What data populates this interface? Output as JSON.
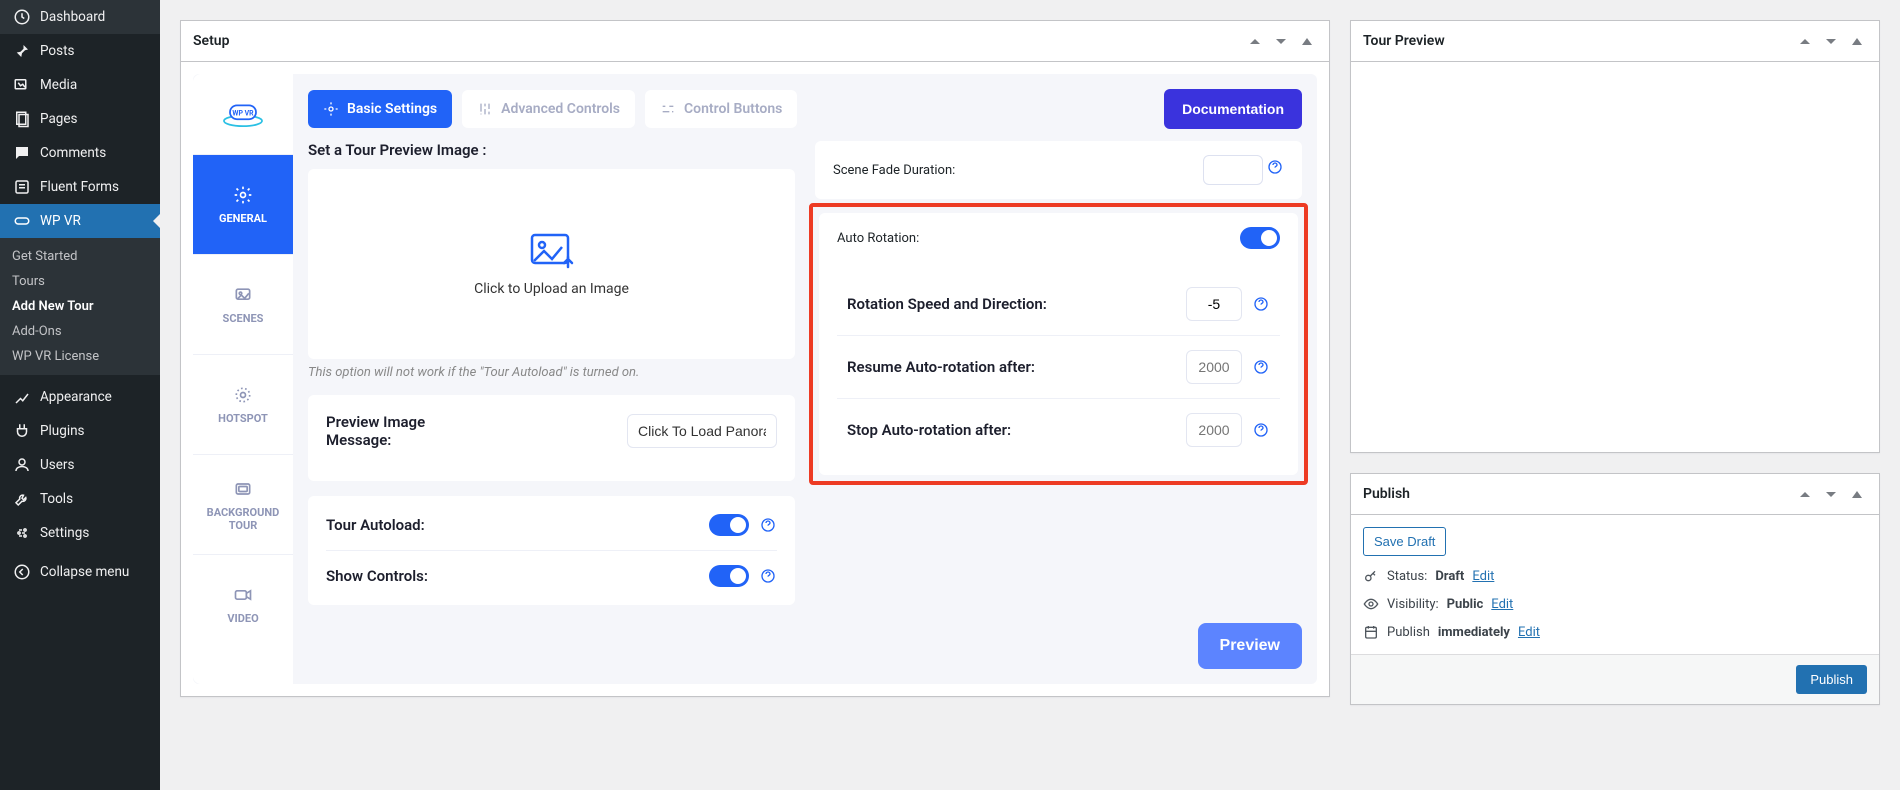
{
  "sidebar": {
    "items": [
      {
        "label": "Dashboard",
        "icon": "dashboard"
      },
      {
        "label": "Posts",
        "icon": "pin"
      },
      {
        "label": "Media",
        "icon": "media"
      },
      {
        "label": "Pages",
        "icon": "pages"
      },
      {
        "label": "Comments",
        "icon": "comments"
      },
      {
        "label": "Fluent Forms",
        "icon": "forms"
      },
      {
        "label": "WP VR",
        "icon": "wpvr",
        "active": true
      },
      {
        "label": "Appearance",
        "icon": "appearance"
      },
      {
        "label": "Plugins",
        "icon": "plugins"
      },
      {
        "label": "Users",
        "icon": "users"
      },
      {
        "label": "Tools",
        "icon": "tools"
      },
      {
        "label": "Settings",
        "icon": "settings"
      },
      {
        "label": "Collapse menu",
        "icon": "collapse"
      }
    ],
    "submenu": [
      {
        "label": "Get Started"
      },
      {
        "label": "Tours"
      },
      {
        "label": "Add New Tour",
        "current": true
      },
      {
        "label": "Add-Ons"
      },
      {
        "label": "WP VR License"
      }
    ]
  },
  "setup": {
    "title": "Setup",
    "tabs": {
      "basic": "Basic Settings",
      "advanced": "Advanced Controls",
      "control": "Control Buttons"
    },
    "doc_btn": "Documentation",
    "left_tabs": {
      "general": "GENERAL",
      "scenes": "SCENES",
      "hotspot": "HOTSPOT",
      "background": "BACKGROUND TOUR",
      "video": "VIDEO"
    },
    "left_col": {
      "preview_image_label": "Set a Tour Preview Image :",
      "upload_text": "Click to Upload an Image",
      "upload_hint": "This option will not work if the \"Tour Autoload\" is turned on.",
      "preview_msg_label": "Preview Image Message:",
      "preview_msg_value": "Click To Load Panoram",
      "tour_autoload_label": "Tour Autoload:",
      "show_controls_label": "Show Controls:"
    },
    "right_col": {
      "fade_label": "Scene Fade Duration:",
      "auto_rotation_label": "Auto Rotation:",
      "rotation_speed_label": "Rotation Speed and Direction:",
      "rotation_speed_value": "-5",
      "resume_label": "Resume Auto-rotation after:",
      "resume_placeholder": "2000",
      "stop_label": "Stop Auto-rotation after:",
      "stop_placeholder": "2000"
    },
    "preview_btn": "Preview"
  },
  "tour_preview": {
    "title": "Tour Preview"
  },
  "publish": {
    "title": "Publish",
    "save_draft": "Save Draft",
    "status_label": "Status:",
    "status_value": "Draft",
    "visibility_label": "Visibility:",
    "visibility_value": "Public",
    "publish_label": "Publish",
    "publish_value": "immediately",
    "edit": "Edit",
    "publish_btn": "Publish"
  },
  "colors": {
    "accent": "#2163F7",
    "wp_blue": "#2271b1",
    "red_highlight": "#ED3B24"
  }
}
